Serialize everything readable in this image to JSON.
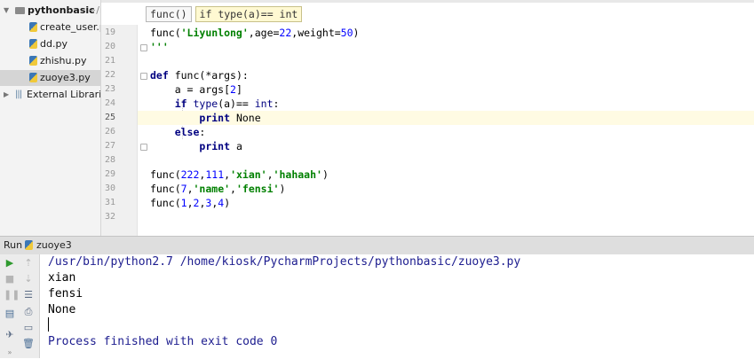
{
  "project_tree": {
    "root": {
      "name": "pythonbasic",
      "path_hint": "~/F"
    },
    "files": [
      "create_user.p",
      "dd.py",
      "zhishu.py",
      "zuoye3.py"
    ],
    "selected_file": "zuoye3.py",
    "external": "External Librarie"
  },
  "breadcrumb": [
    "func()",
    "if type(a)== int"
  ],
  "gutter": {
    "line_numbers": [
      "19",
      "20",
      "21",
      "22",
      "23",
      "24",
      "25",
      "26",
      "27",
      "28",
      "29",
      "30",
      "31",
      "32"
    ],
    "current_line": "25"
  },
  "code_lines": [
    "func('Liyunlong',age=22,weight=50)",
    "'''",
    "",
    "def func(*args):",
    "    a = args[2]",
    "    if type(a)== int:",
    "        print None",
    "    else:",
    "        print a",
    "",
    "func(222,111,'xian','hahaah')",
    "func(7,'name','fensi')",
    "func(1,2,3,4)",
    ""
  ],
  "run_panel": {
    "title": "Run",
    "config": "zuoye3",
    "command": "/usr/bin/python2.7 /home/kiosk/PycharmProjects/pythonbasic/zuoye3.py",
    "output": [
      "xian",
      "fensi",
      "None"
    ],
    "exit_message": "Process finished with exit code 0"
  },
  "icons": {
    "run": "play-icon",
    "stop": "stop-icon",
    "pause": "pause-icon",
    "scroll_up": "arrow-up-icon",
    "scroll_down": "arrow-down-icon",
    "soft_wrap": "soft-wrap-icon",
    "dump": "dump-threads-icon",
    "print": "print-icon",
    "pin": "pin-icon",
    "trash": "trash-icon"
  },
  "colors": {
    "keyword": "#000080",
    "string": "#008000",
    "number": "#0000ff",
    "run_green": "#3a9a3a",
    "current_line": "#fffbe3"
  }
}
